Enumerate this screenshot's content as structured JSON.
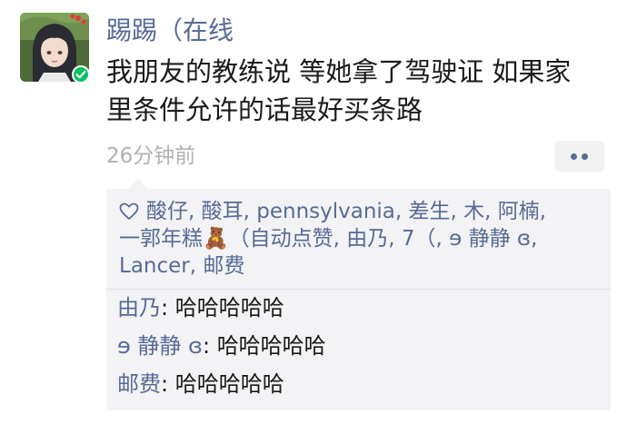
{
  "post": {
    "nickname": "踢踢（在线",
    "content_lines": [
      "我朋友的教练说 等她拿了驾驶证 如果家",
      "里条件允许的话最好买条路"
    ],
    "time": "26分钟前"
  },
  "likes": {
    "lines": [
      "酸仔, 酸耳, pennsylvania, 差生, 木, 阿楠,",
      "一郭年糕🧸（自动点赞, 由乃, 7（, ɘ 静静 ɞ,",
      "Lancer, 邮费"
    ]
  },
  "comments": [
    {
      "name": "由乃",
      "sep": ": ",
      "text": "哈哈哈哈哈"
    },
    {
      "name": "ɘ 静静 ɞ",
      "sep": ": ",
      "text": "哈哈哈哈哈"
    },
    {
      "name": "邮费",
      "sep": ": ",
      "text": "哈哈哈哈哈"
    }
  ],
  "icons": {
    "avatar": "anime-avatar",
    "online": "checkmark-icon",
    "more": "more-dots-icon",
    "like": "heart-outline-icon"
  },
  "colors": {
    "link_blue": "#576b95",
    "text": "#1a1a1a",
    "muted": "#b2b2b2",
    "comment_bg": "#f3f3f5",
    "online_green": "#07c160"
  }
}
